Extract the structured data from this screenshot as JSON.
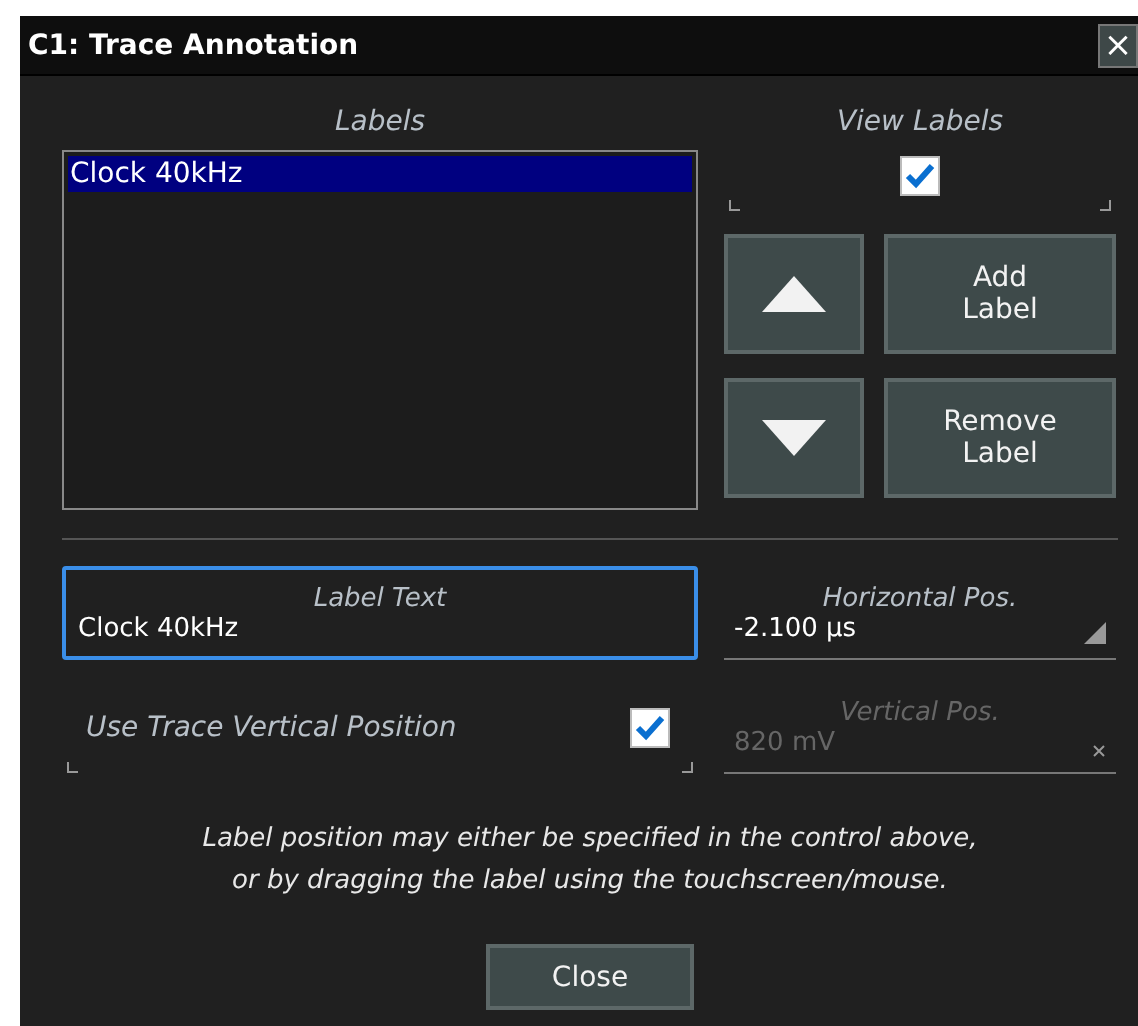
{
  "window": {
    "title": "C1: Trace Annotation",
    "close_glyph": "×"
  },
  "labels_list": {
    "heading": "Labels",
    "items": [
      {
        "text": "Clock 40kHz",
        "selected": true
      }
    ]
  },
  "view_labels": {
    "label": "View Labels",
    "checked": true
  },
  "buttons": [
    {
      "kind": "up"
    },
    {
      "kind": "text",
      "label": "Add\nLabel"
    },
    {
      "kind": "down"
    },
    {
      "kind": "text",
      "label": "Remove\nLabel"
    }
  ],
  "label_text": {
    "label": "Label Text",
    "value": "Clock 40kHz",
    "focused": true
  },
  "horizontal_pos": {
    "label": "Horizontal Pos.",
    "value": "-2.100 µs",
    "disabled": false
  },
  "use_trace_vertical": {
    "label": "Use Trace Vertical Position",
    "checked": true
  },
  "vertical_pos": {
    "label": "Vertical Pos.",
    "value": "820 mV",
    "disabled": true
  },
  "note": "Label position may either be specified in the control above,\nor by dragging the label using the touchscreen/mouse.",
  "close_button": "Close"
}
